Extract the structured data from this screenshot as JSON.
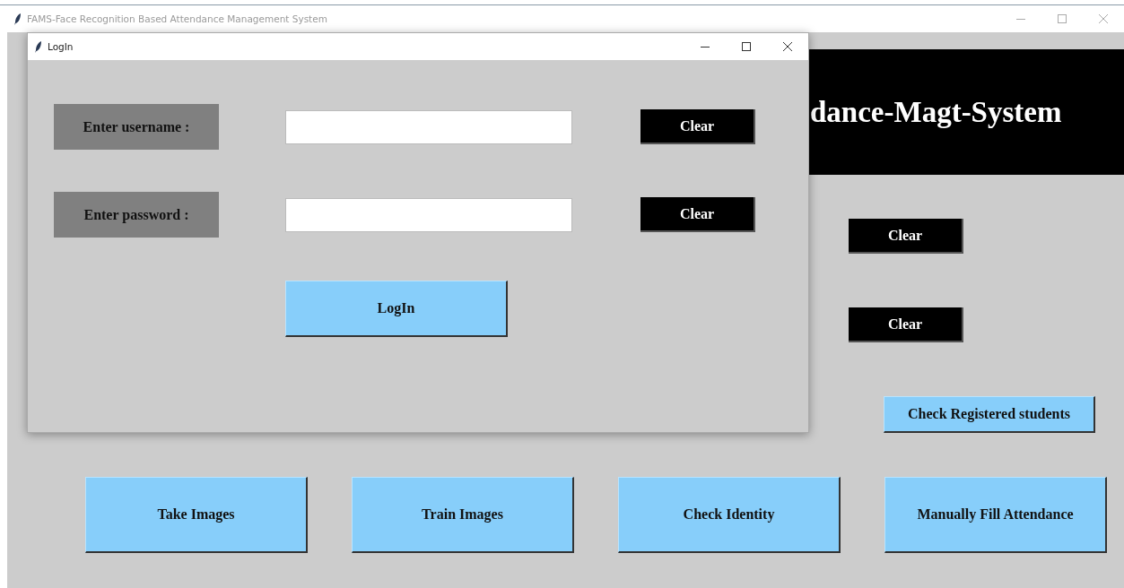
{
  "main_window": {
    "title": "FAMS-Face Recognition Based Attendance Management System",
    "banner": "dance-Magt-System",
    "clear_buttons": [
      "Clear",
      "Clear"
    ],
    "check_button": "Check Registered students",
    "actions": [
      "Take Images",
      "Train Images",
      "Check Identity",
      "Manually Fill Attendance"
    ]
  },
  "login_dialog": {
    "title": "LogIn",
    "fields": [
      {
        "label": "Enter username :",
        "clear": "Clear"
      },
      {
        "label": "Enter password :",
        "clear": "Clear"
      }
    ],
    "submit": "LogIn"
  }
}
